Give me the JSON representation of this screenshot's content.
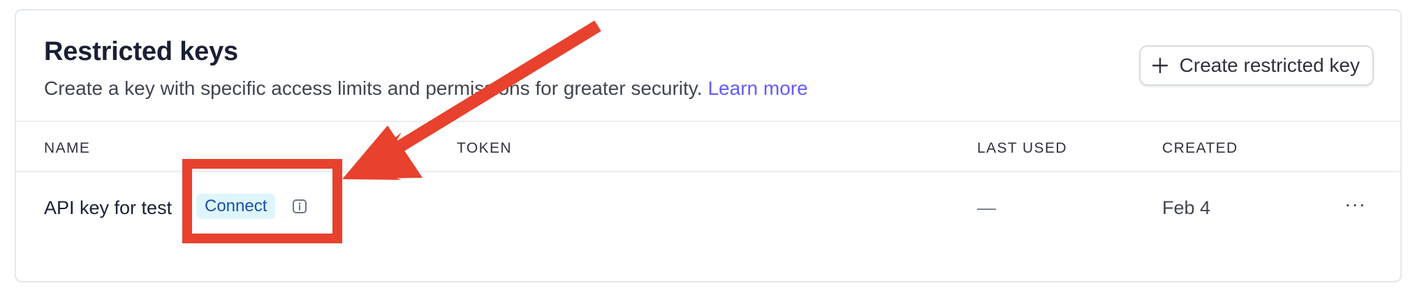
{
  "section": {
    "title": "Restricted keys",
    "subtitle": "Create a key with specific access limits and permissions for greater security.",
    "learn_more": "Learn more",
    "create_button": "Create restricted key"
  },
  "table": {
    "columns": [
      "NAME",
      "TOKEN",
      "LAST USED",
      "CREATED"
    ],
    "rows": [
      {
        "name": "API key for test",
        "badge": "Connect",
        "token": "",
        "last_used": "—",
        "created": "Feb 4",
        "actions": "···"
      }
    ]
  },
  "icons": {
    "create": "plus-icon",
    "info": "info-icon",
    "more": "more-actions-icon"
  },
  "colors": {
    "accent_link": "#635bff",
    "badge_bg": "#def6fb",
    "badge_text": "#1d4fa0",
    "annotation": "#e8412d"
  }
}
